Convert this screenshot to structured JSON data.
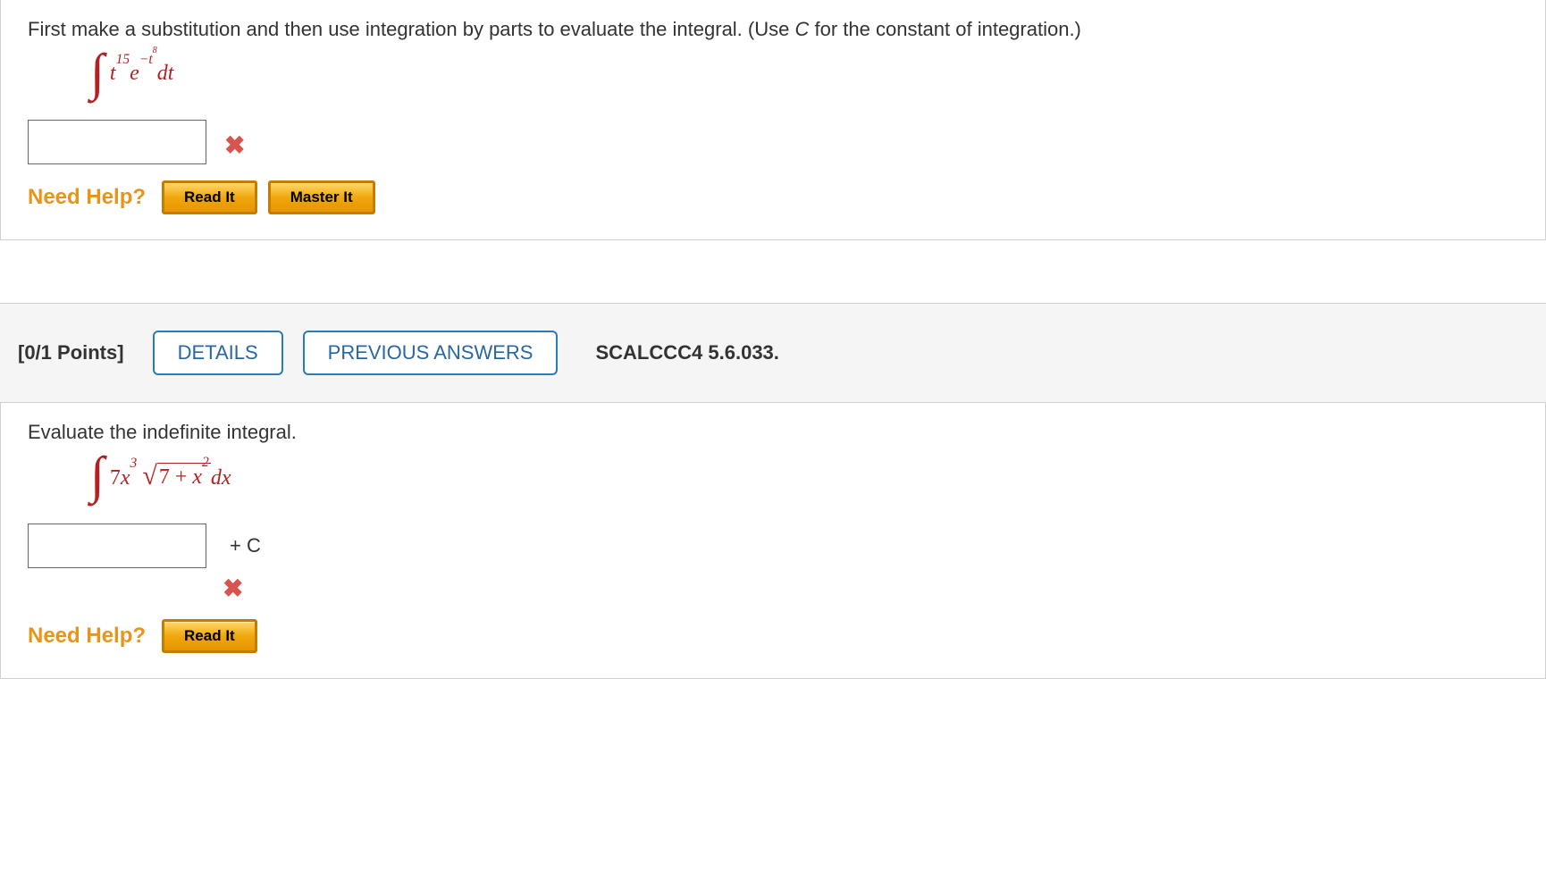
{
  "q1": {
    "prompt_pre": "First make a substitution and then use integration by parts to evaluate the integral. (Use ",
    "prompt_const": "C",
    "prompt_post": " for the constant of integration.)",
    "integral_base": "t",
    "integral_exp1": "15",
    "integral_e": "e",
    "integral_exp2_neg": "−t",
    "integral_exp2_sup": "8",
    "integral_dt": "dt",
    "answer_value": "",
    "wrong_icon": "✖",
    "need_help": "Need Help?",
    "read_it": "Read It",
    "master_it": "Master It"
  },
  "header": {
    "points": "[0/1 Points]",
    "details": "DETAILS",
    "previous": "PREVIOUS ANSWERS",
    "section": "SCALCCC4 5.6.033."
  },
  "q2": {
    "prompt": "Evaluate the indefinite integral.",
    "coef": "7",
    "x": "x",
    "exp3": "3",
    "sqrt_inner_pre": "7 + ",
    "sqrt_x": "x",
    "sqrt_exp": "2",
    "dx": "dx",
    "answer_value": "",
    "plus_c": "+ C",
    "wrong_icon": "✖",
    "need_help": "Need Help?",
    "read_it": "Read It"
  }
}
